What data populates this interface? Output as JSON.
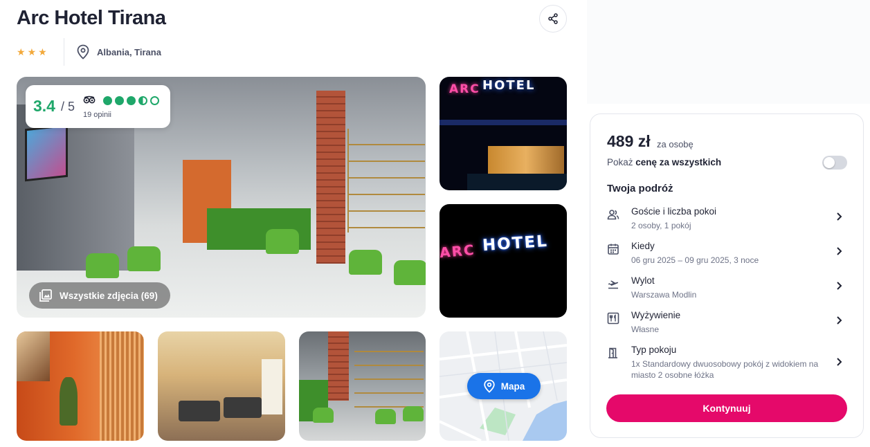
{
  "hotel": {
    "name": "Arc Hotel Tirana",
    "stars": 3,
    "location": "Albania, Tirana"
  },
  "rating": {
    "score": "3.4",
    "max": "/ 5",
    "reviews": "19 opinii",
    "provider_icon": "tripadvisor-icon",
    "dots_value": 3.5,
    "accent": "#1fa76a"
  },
  "gallery": {
    "all_photos_label": "Wszystkie zdjęcia (69)",
    "map_label": "Mapa",
    "neon_text_1": "HOTEL",
    "neon_text_2": "HOTEL",
    "logo_text": "ARC"
  },
  "booking": {
    "price": "489 zł",
    "per_person": "za osobę",
    "show_total_prefix": "Pokaż ",
    "show_total_bold": "cenę za wszystkich",
    "toggle_on": false,
    "trip_title": "Twoja podróż",
    "rows": [
      {
        "icon": "guests-icon",
        "label": "Goście i liczba pokoi",
        "value": "2 osoby, 1 pokój"
      },
      {
        "icon": "calendar-icon",
        "label": "Kiedy",
        "value": "06 gru 2025 – 09 gru 2025, 3 noce"
      },
      {
        "icon": "plane-departure-icon",
        "label": "Wylot",
        "value": "Warszawa Modlin"
      },
      {
        "icon": "meals-icon",
        "label": "Wyżywienie",
        "value": "Własne"
      },
      {
        "icon": "room-door-icon",
        "label": "Typ pokoju",
        "value": "1x Standardowy dwuosobowy pokój z widokiem na miasto 2 osobne łóżka"
      }
    ],
    "cta_label": "Kontynuuj",
    "cta_color": "#e5096a"
  }
}
